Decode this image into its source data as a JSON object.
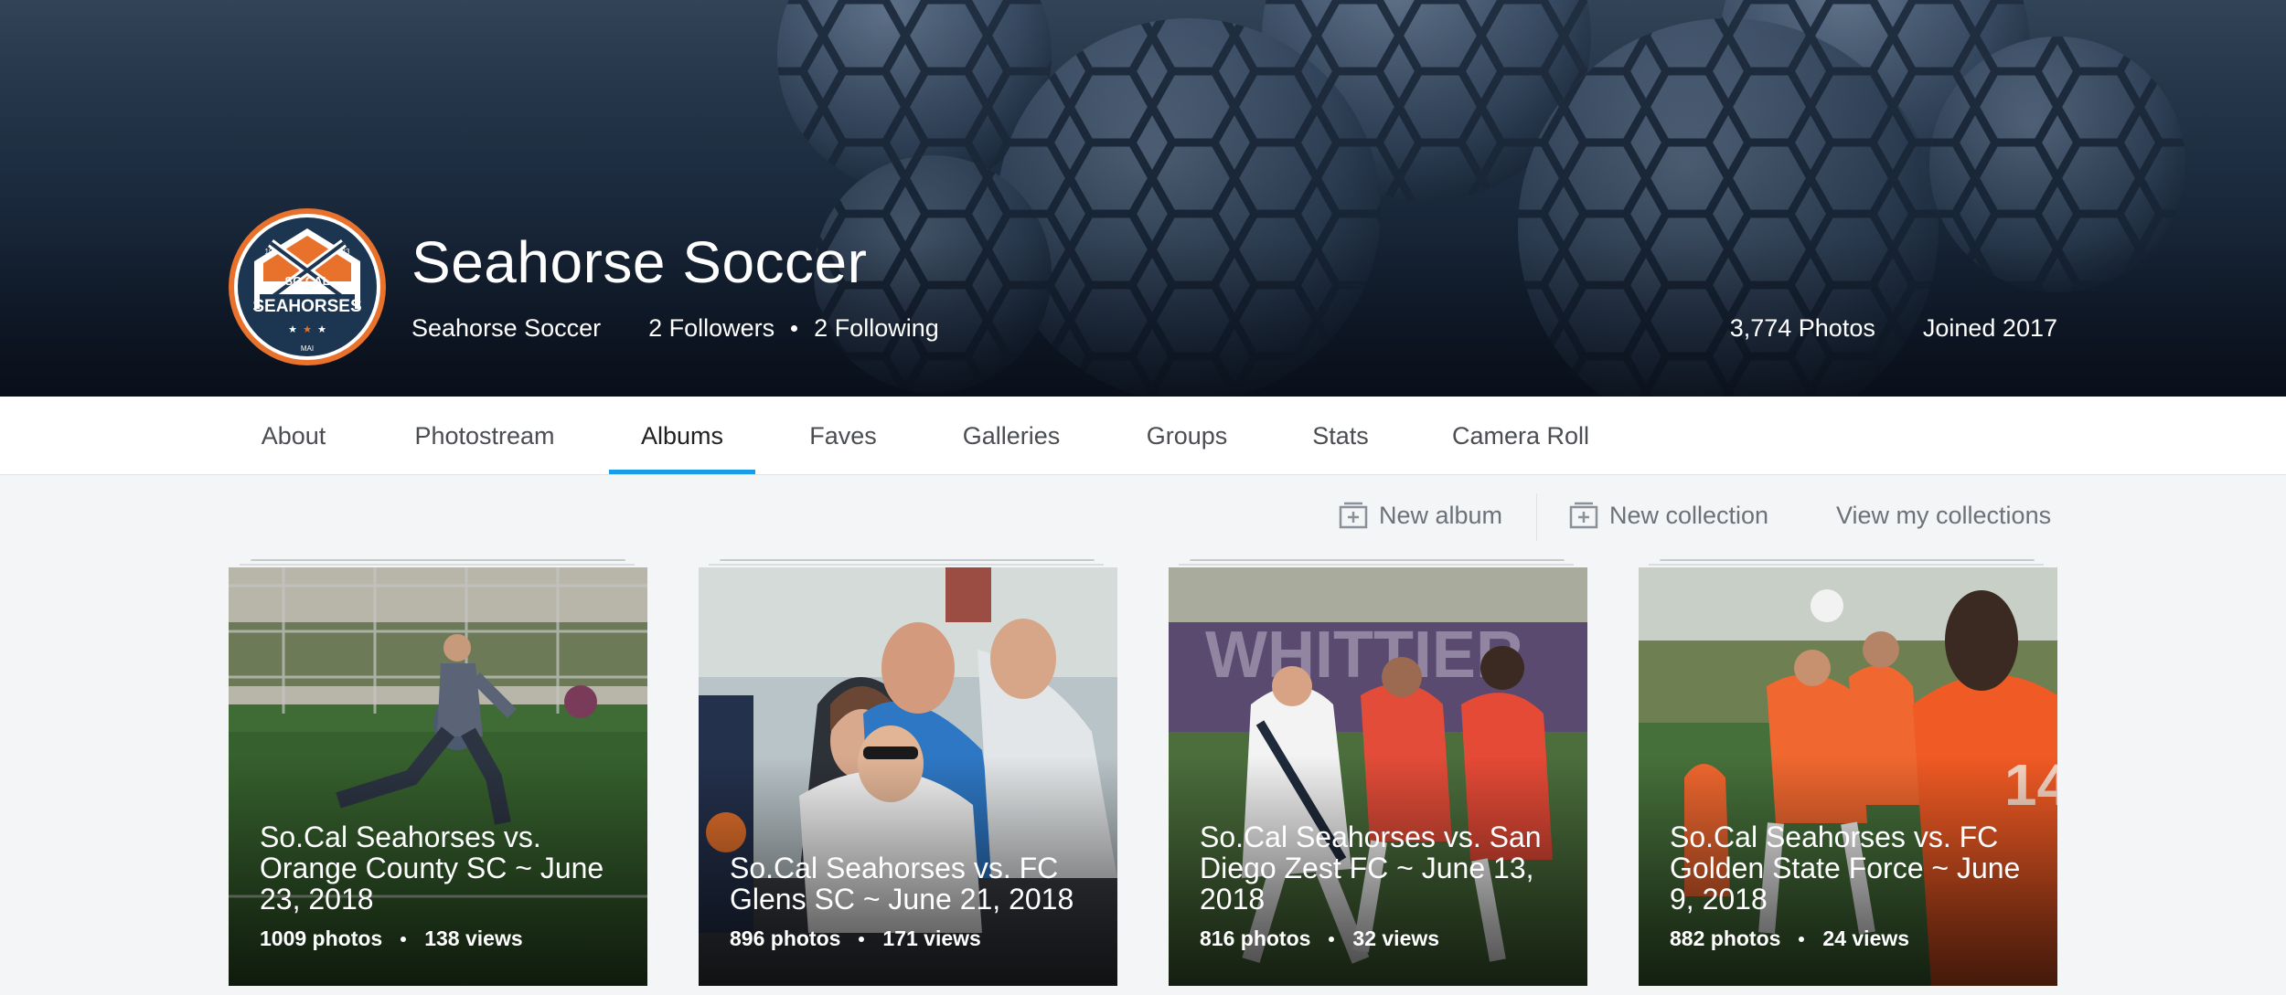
{
  "profile": {
    "name": "Seahorse Soccer",
    "username": "Seahorse Soccer",
    "followers": "2 Followers",
    "following": "2 Following",
    "photos": "3,774 Photos",
    "joined": "Joined 2017",
    "logo": {
      "line1": "SO.CAL",
      "line2": "SEAHORSES",
      "year_left": "19",
      "year_right": "83",
      "bottom": "MAI",
      "accent_color": "#e8722c",
      "navy_color": "#1c3550"
    }
  },
  "tabs": [
    {
      "label": "About"
    },
    {
      "label": "Photostream"
    },
    {
      "label": "Albums",
      "active": true
    },
    {
      "label": "Faves"
    },
    {
      "label": "Galleries"
    },
    {
      "label": "Groups"
    },
    {
      "label": "Stats"
    },
    {
      "label": "Camera Roll"
    }
  ],
  "toolbar": {
    "new_album": "New album",
    "new_collection": "New collection",
    "view_collections": "View my collections"
  },
  "albums": [
    {
      "title": "So.Cal Seahorses vs. Orange County SC ~ June 23, 2018",
      "photos": "1009 photos",
      "views": "138 views"
    },
    {
      "title": "So.Cal Seahorses vs. FC Glens SC ~ June 21, 2018",
      "photos": "896 photos",
      "views": "171 views"
    },
    {
      "title": "So.Cal Seahorses vs. San Diego Zest FC ~ June 13, 2018",
      "photos": "816 photos",
      "views": "32 views"
    },
    {
      "title": "So.Cal Seahorses vs. FC Golden State Force ~ June 9, 2018",
      "photos": "882 photos",
      "views": "24 views"
    }
  ],
  "colors": {
    "accent": "#1c9be6",
    "cover_dark": "#0f1a28",
    "page_bg": "#f3f5f6"
  }
}
